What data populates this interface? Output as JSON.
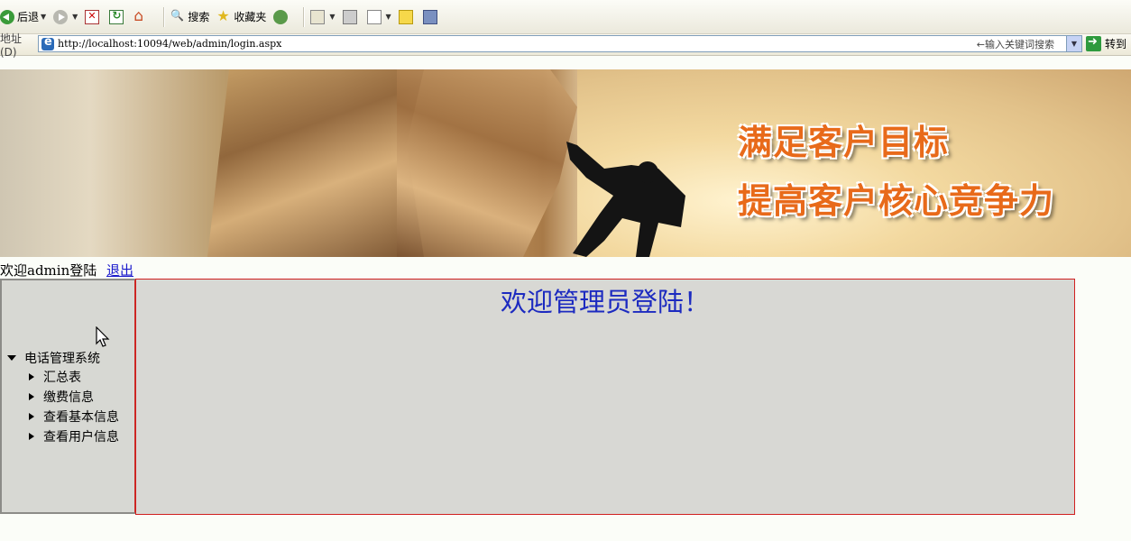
{
  "toolbar": {
    "back_label": "后退",
    "search_label": "搜索",
    "favorites_label": "收藏夹"
  },
  "address": {
    "label": "地址(D)",
    "url": "http://localhost:10094/web/admin/login.aspx",
    "search_hint": "←输入关键词搜索",
    "go_label": "转到"
  },
  "banner": {
    "slogan_1": "满足客户目标",
    "slogan_2": "提高客户核心竞争力",
    "slogan_color": "#e86a1a"
  },
  "welcome": {
    "text": "欢迎admin登陆",
    "logout": "退出"
  },
  "main": {
    "title": "欢迎管理员登陆！",
    "title_color": "#1c2ac0"
  },
  "nav_tree": {
    "root": "电话管理系统",
    "items": [
      {
        "label": "汇总表"
      },
      {
        "label": "缴费信息"
      },
      {
        "label": "查看基本信息"
      },
      {
        "label": "查看用户信息"
      }
    ]
  },
  "icons": {
    "back": "back-arrow-icon",
    "forward": "forward-arrow-icon",
    "stop": "stop-icon",
    "refresh": "refresh-icon",
    "home": "home-icon",
    "search": "search-icon",
    "favorites": "star-icon",
    "media": "media-icon",
    "mail": "mail-icon",
    "print": "print-icon",
    "edit": "edit-icon",
    "notes": "notes-icon",
    "messenger": "messenger-icon",
    "go": "go-arrow-icon"
  }
}
